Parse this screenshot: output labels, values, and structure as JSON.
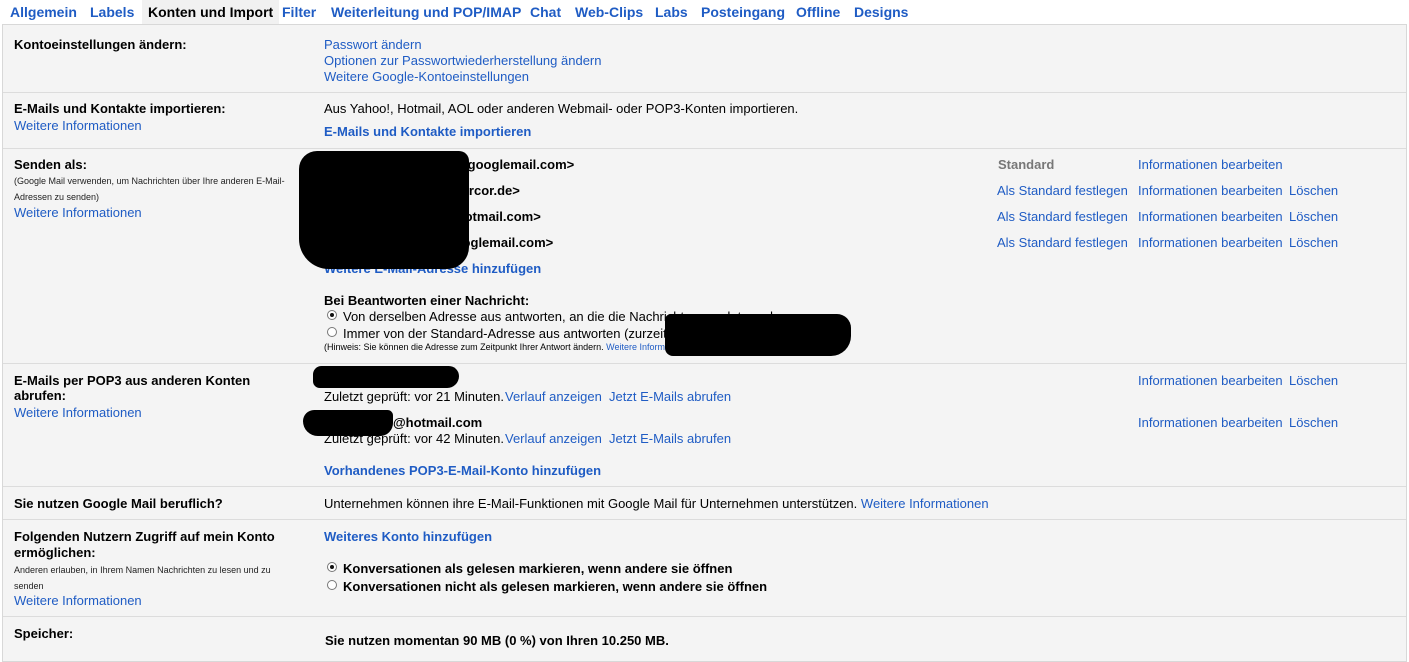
{
  "tabs": [
    {
      "label": "Allgemein"
    },
    {
      "label": "Labels"
    },
    {
      "label": "Konten und Import"
    },
    {
      "label": "Filter"
    },
    {
      "label": "Weiterleitung und POP/IMAP"
    },
    {
      "label": "Chat"
    },
    {
      "label": "Web-Clips"
    },
    {
      "label": "Labs"
    },
    {
      "label": "Posteingang"
    },
    {
      "label": "Offline"
    },
    {
      "label": "Designs"
    }
  ],
  "more_info": "Weitere Informationen",
  "account": {
    "label": "Kontoeinstellungen ändern:",
    "links": [
      "Passwort ändern",
      "Optionen zur Passwortwiederherstellung ändern",
      "Weitere Google-Kontoeinstellungen"
    ]
  },
  "import": {
    "label": "E-Mails und Kontakte importieren:",
    "description": "Aus Yahoo!, Hotmail, AOL oder anderen Webmail- oder POP3-Konten importieren.",
    "action": "E-Mails und Kontakte importieren"
  },
  "send_as": {
    "label": "Senden als:",
    "note": "(Google Mail verwenden, um Nachrichten über Ihre anderen E-Mail-Adressen zu senden)",
    "addresses": [
      {
        "email": "@googlemail.com>",
        "status": "Standard",
        "edit": "Informationen bearbeiten"
      },
      {
        "email": "@arcor.de>",
        "make_default": "Als Standard festlegen",
        "edit": "Informationen bearbeiten",
        "delete": "Löschen"
      },
      {
        "email": "@hotmail.com>",
        "make_default": "Als Standard festlegen",
        "edit": "Informationen bearbeiten",
        "delete": "Löschen"
      },
      {
        "email": "@googlemail.com>",
        "make_default": "Als Standard festlegen",
        "edit": "Informationen bearbeiten",
        "delete": "Löschen"
      }
    ],
    "add_address": "Weitere E-Mail-Adresse hinzufügen",
    "reply_label": "Bei Beantworten einer Nachricht:",
    "reply_options": [
      "Von derselben Adresse aus antworten, an die die Nachricht gesendet wurde",
      "Immer von der Standard-Adresse aus antworten (zurzeit"
    ],
    "hint": "(Hinweis: Sie können die Adresse zum Zeitpunkt Ihrer Antwort ändern."
  },
  "pop3": {
    "label": "E-Mails per POP3 aus anderen Konten abrufen:",
    "accounts": [
      {
        "email": "",
        "status": "Zuletzt geprüft: vor 21 Minuten.",
        "history": "Verlauf anzeigen",
        "fetch": "Jetzt E-Mails abrufen",
        "edit": "Informationen bearbeiten",
        "delete": "Löschen"
      },
      {
        "email": "@hotmail.com",
        "status": "Zuletzt geprüft: vor 42 Minuten.",
        "history": "Verlauf anzeigen",
        "fetch": "Jetzt E-Mails abrufen",
        "edit": "Informationen bearbeiten",
        "delete": "Löschen"
      }
    ],
    "add_account": "Vorhandenes POP3-E-Mail-Konto hinzufügen"
  },
  "business": {
    "label": "Sie nutzen Google Mail beruflich?",
    "text": "Unternehmen können ihre E-Mail-Funktionen mit Google Mail für Unternehmen unterstützen."
  },
  "delegation": {
    "label": "Folgenden Nutzern Zugriff auf mein Konto ermöglichen:",
    "note": "Anderen erlauben, in Ihrem Namen Nachrichten zu lesen und zu senden",
    "add": "Weiteres Konto hinzufügen",
    "options": [
      "Konversationen als gelesen markieren, wenn andere sie öffnen",
      "Konversationen nicht als gelesen markieren, wenn andere sie öffnen"
    ]
  },
  "storage": {
    "label": "Speicher:",
    "text": "Sie nutzen momentan 90 MB (0 %) von Ihren 10.250 MB."
  }
}
